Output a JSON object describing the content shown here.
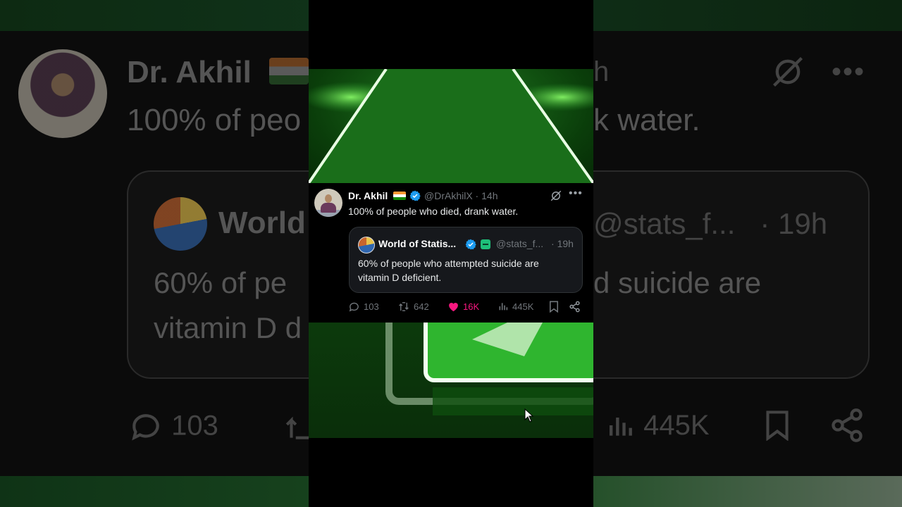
{
  "tweet": {
    "author_name": "Dr. Akhil",
    "handle": "@DrAkhilX",
    "time": "14h",
    "text": "100% of people who died, drank water.",
    "quote": {
      "author_name": "World of Statis...",
      "handle": "@stats_f...",
      "time": "19h",
      "text": "60% of people who attempted suicide are vitamin D deficient."
    },
    "actions": {
      "replies": "103",
      "reposts": "642",
      "likes": "16K",
      "views": "445K"
    }
  },
  "background": {
    "name": "Dr. Akhil",
    "time_fragment": "h",
    "text_left": "100% of peo",
    "text_right": "k water.",
    "quote_name": "World",
    "quote_handle": "@stats_f...",
    "quote_time": "· 19h",
    "quote_text_left": "60% of pe",
    "quote_text_right": "d suicide are",
    "quote_text_line2": "vitamin D d",
    "replies": "103",
    "views": "445K"
  },
  "colors": {
    "like": "#f91880",
    "verified": "#1d9bf0",
    "muted": "#71767b",
    "scene_green": "#1f7a1f"
  }
}
